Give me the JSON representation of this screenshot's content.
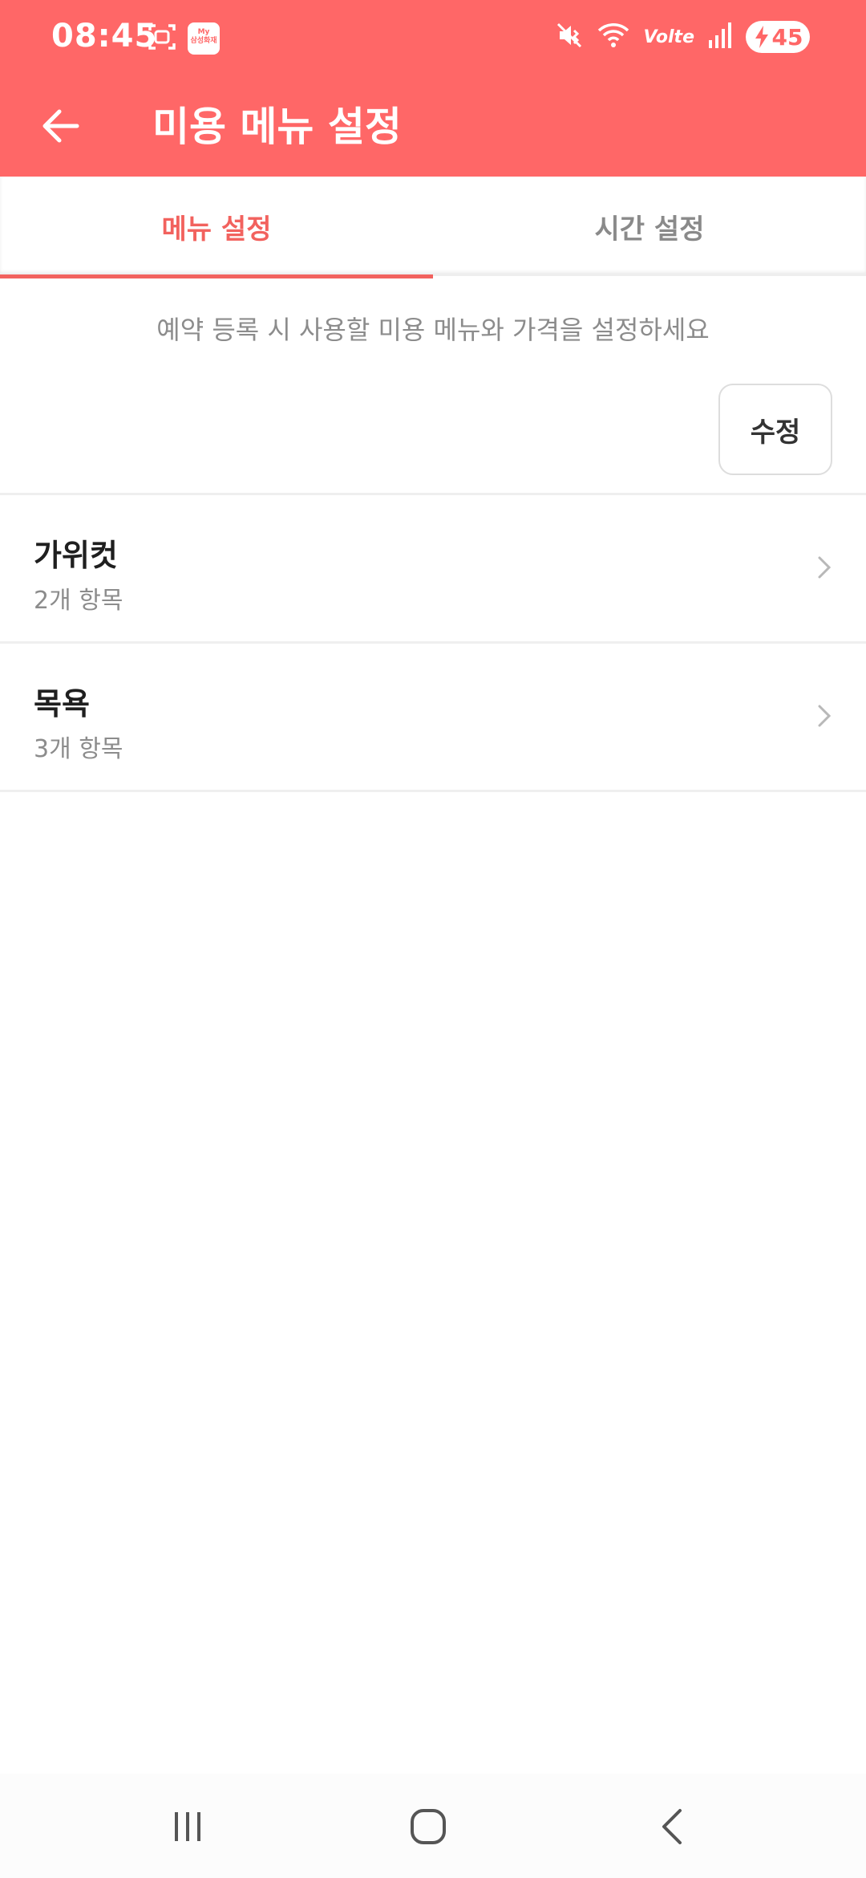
{
  "status_bar": {
    "time": "08:45",
    "app_badge_text": "My\n삼성화재",
    "network_label": "Volte",
    "battery": "45",
    "icons": [
      "screenshot-icon",
      "mute-icon",
      "wifi-icon",
      "signal-icon",
      "battery-charging-icon"
    ]
  },
  "header": {
    "title": "미용 메뉴 설정",
    "back_icon": "arrow-left-icon",
    "background_color": "#ff6767"
  },
  "tabs": [
    {
      "label": "메뉴 설정",
      "active": true
    },
    {
      "label": "시간 설정",
      "active": false
    }
  ],
  "accent_color": "#f2625e",
  "description": "예약 등록 시 사용할 미용 메뉴와 가격을 설정하세요",
  "edit_button_label": "수정",
  "menu_items": [
    {
      "title": "가위컷",
      "subtitle": "2개 항목"
    },
    {
      "title": "목욕",
      "subtitle": "3개 항목"
    }
  ],
  "nav_bar": {
    "icons": [
      "recent-apps-icon",
      "home-icon",
      "back-icon"
    ]
  }
}
